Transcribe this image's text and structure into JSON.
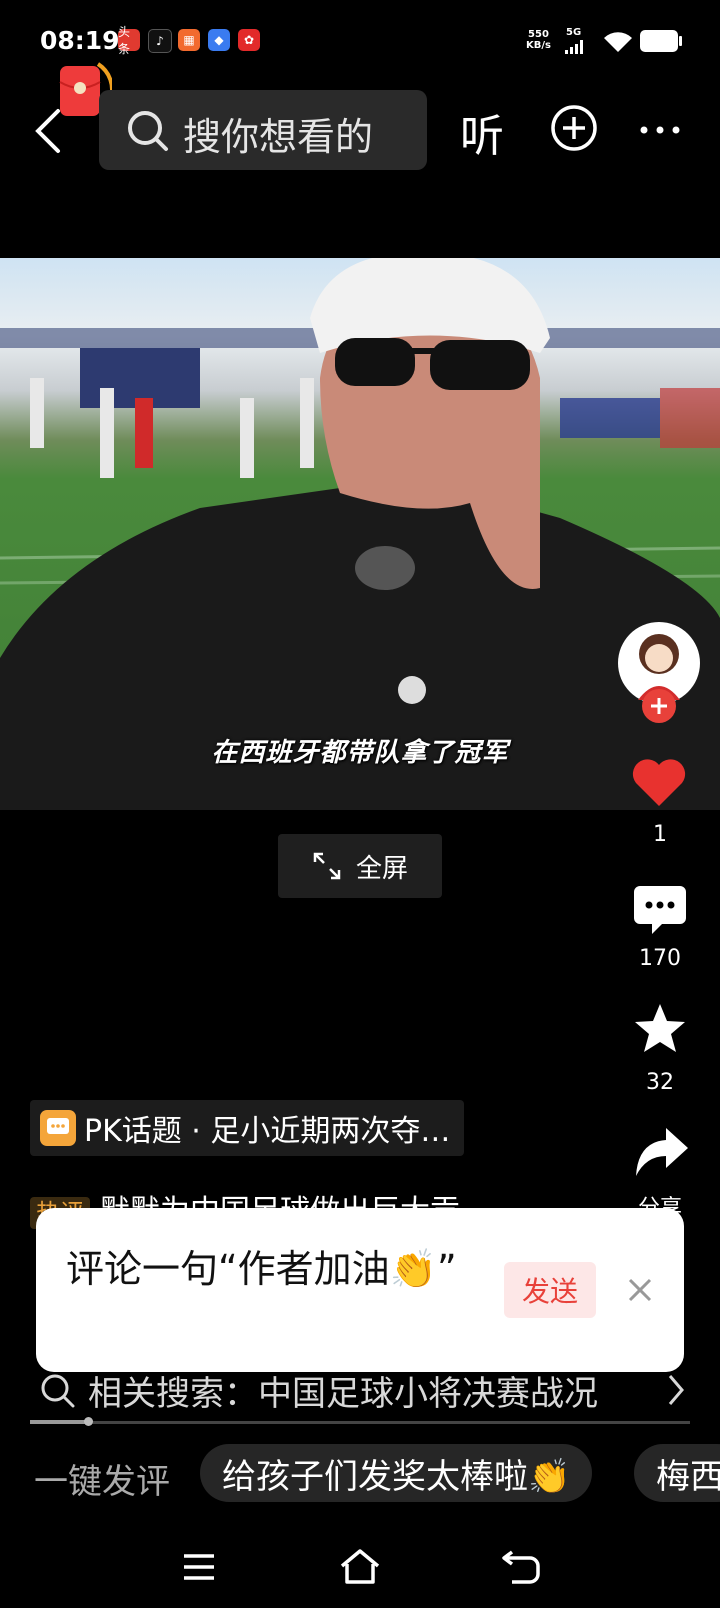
{
  "status_bar": {
    "time": "08:19",
    "app_badges": [
      "头条",
      "TikTok",
      "apps",
      "blue-app",
      "gift"
    ],
    "net_speed_value": "550",
    "net_speed_unit": "KB/s",
    "signal_label": "5G"
  },
  "header": {
    "search_placeholder": "搜你想看的",
    "listen_label": "听"
  },
  "video": {
    "subtitle": "在西班牙都带队拿了冠军",
    "fullscreen_label": "全屏"
  },
  "rail": {
    "like_count": "1",
    "comment_count": "170",
    "favorite_count": "32",
    "share_label": "分享"
  },
  "info": {
    "pk_topic": "PK话题 · 足小近期两次夺…",
    "hot_badge": "热评",
    "hot_comment": "默默为中国足球做出巨大贡"
  },
  "popup": {
    "text": "评论一句“作者加油👏”",
    "send_label": "发送"
  },
  "related": {
    "label": "相关搜索：中国足球小将决赛战况"
  },
  "quick_comment": {
    "label": "一键发评",
    "chips": [
      "给孩子们发奖太棒啦👏",
      "梅西"
    ]
  },
  "colors": {
    "accent_red": "#e8413a",
    "like_red": "#e8322f",
    "pk_orange": "#f4a53a"
  }
}
